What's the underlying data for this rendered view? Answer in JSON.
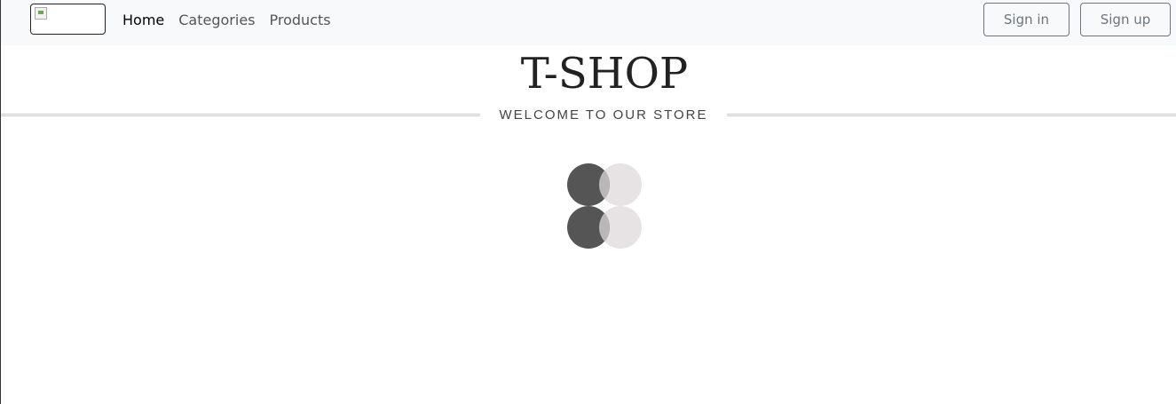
{
  "navbar": {
    "links": [
      {
        "label": "Home",
        "active": true
      },
      {
        "label": "Categories",
        "active": false
      },
      {
        "label": "Products",
        "active": false
      }
    ],
    "signin_label": "Sign in",
    "signup_label": "Sign up"
  },
  "hero": {
    "title": "T-SHOP",
    "tagline": "WELCOME TO OUR STORE"
  },
  "colors": {
    "navbar_bg": "#f8f9fa",
    "loader_dark": "#555555",
    "loader_light": "#e7e2e3",
    "button_outline": "#6c757d"
  }
}
